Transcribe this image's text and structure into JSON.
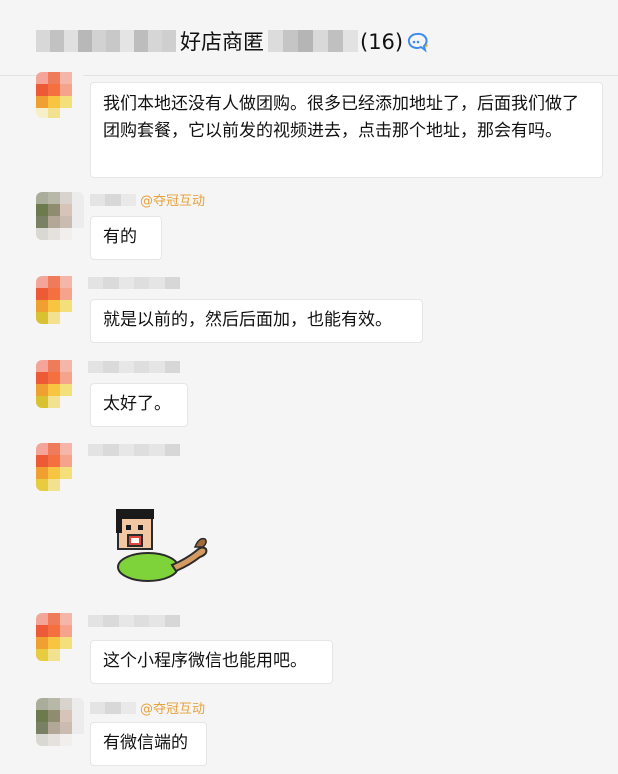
{
  "header": {
    "group_name": "好店商匿",
    "member_count": "(16)",
    "group_icon": "group-chat-icon"
  },
  "messages": [
    {
      "text": "我们本地还没有人做团购。很多已经添加地址了，后面我们做了团购套餐，它以前发的视频进去，点击那个地址，那会有吗。"
    },
    {
      "tag": "@夺冠互动",
      "text": "有的"
    },
    {
      "text": "就是以前的，然后后面加，也能有效。"
    },
    {
      "text": "太好了。"
    },
    {
      "sticker": "cartoon-man-sticker"
    },
    {
      "text": "这个小程序微信也能用吧。"
    },
    {
      "tag": "@夺冠互动",
      "text": "有微信端的"
    }
  ],
  "colors": {
    "background": "#f5f5f5",
    "bubble": "#ffffff",
    "tag": "#e6a23c"
  }
}
